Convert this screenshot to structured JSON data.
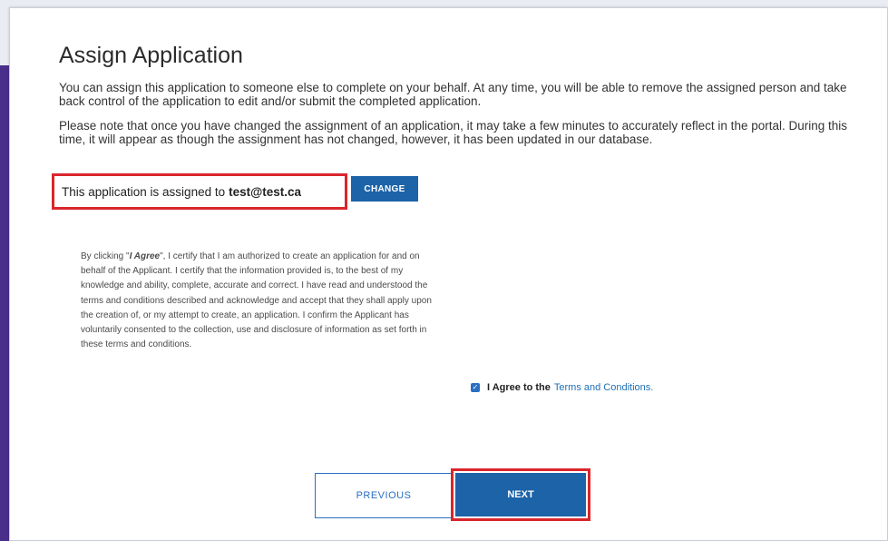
{
  "page": {
    "title": "Assign Application",
    "paragraph1": "You can assign this application to someone else to complete on your behalf. At any time, you will be able to remove the assigned person and take back control of the application to edit and/or submit the completed application.",
    "paragraph2": "Please note that once you have changed the assignment of an application, it may take a few minutes to accurately reflect in the portal. During this time, it will appear as though the assignment has not changed, however, it has been updated in our database."
  },
  "assignment": {
    "prefix": "This application is assigned to",
    "email": "test@test.ca",
    "change_label": "CHANGE"
  },
  "terms": {
    "intro": "By clicking \"",
    "agree_word": "I Agree",
    "body": "\", I certify that I am authorized to create an application for and on behalf of the Applicant. I certify that the information provided is, to the best of my knowledge and ability, complete, accurate and correct. I have read and understood the terms and conditions described and acknowledge and accept that they shall apply upon the creation of, or my attempt to create, an application. I confirm the Applicant has voluntarily consented to the collection, use and disclosure of information as set forth in these terms and conditions."
  },
  "agree": {
    "checked": true,
    "label": "I Agree to the",
    "link": "Terms and Conditions."
  },
  "nav": {
    "previous_label": "PREVIOUS",
    "next_label": "NEXT"
  },
  "colors": {
    "primary": "#1c63a8",
    "highlight": "#d9262b",
    "side_band": "#4a2f8a"
  }
}
